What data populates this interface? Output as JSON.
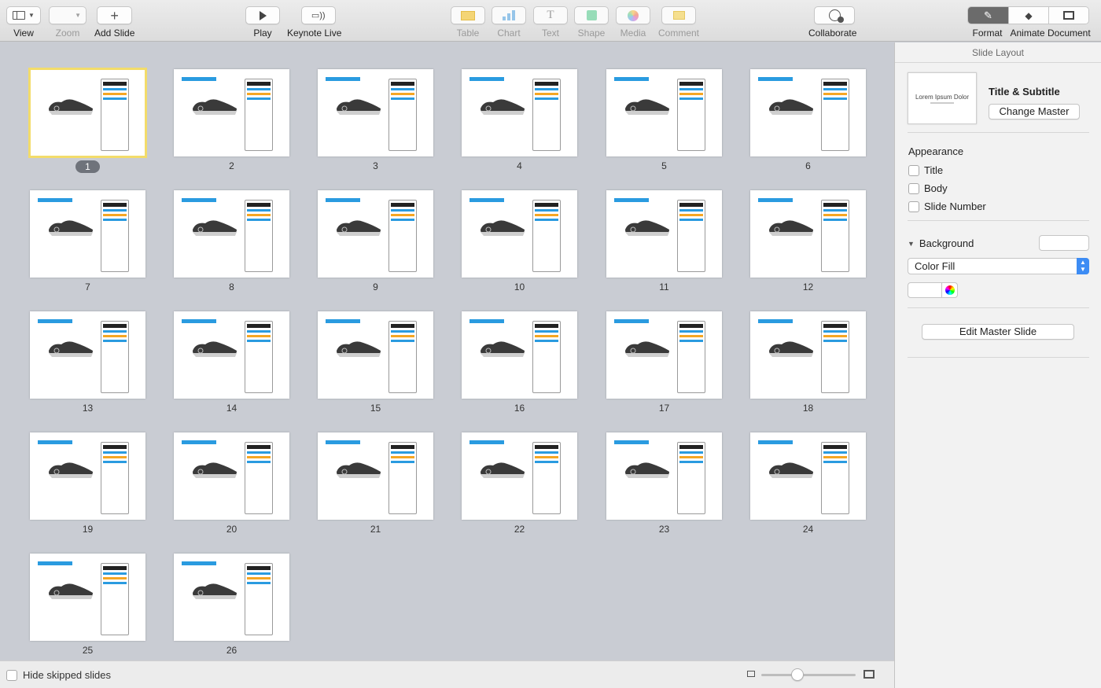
{
  "toolbar": {
    "view_label": "View",
    "zoom_label": "Zoom",
    "add_slide_label": "Add Slide",
    "play_label": "Play",
    "keynote_live_label": "Keynote Live",
    "table_label": "Table",
    "chart_label": "Chart",
    "text_label": "Text",
    "shape_label": "Shape",
    "media_label": "Media",
    "comment_label": "Comment",
    "collaborate_label": "Collaborate",
    "format_label": "Format",
    "animate_label": "Animate",
    "document_label": "Document"
  },
  "slides": [
    {
      "num": "1"
    },
    {
      "num": "2"
    },
    {
      "num": "3"
    },
    {
      "num": "4"
    },
    {
      "num": "5"
    },
    {
      "num": "6"
    },
    {
      "num": "7"
    },
    {
      "num": "8"
    },
    {
      "num": "9"
    },
    {
      "num": "10"
    },
    {
      "num": "11"
    },
    {
      "num": "12"
    },
    {
      "num": "13"
    },
    {
      "num": "14"
    },
    {
      "num": "15"
    },
    {
      "num": "16"
    },
    {
      "num": "17"
    },
    {
      "num": "18"
    },
    {
      "num": "19"
    },
    {
      "num": "20"
    },
    {
      "num": "21"
    },
    {
      "num": "22"
    },
    {
      "num": "23"
    },
    {
      "num": "24"
    },
    {
      "num": "25"
    },
    {
      "num": "26"
    }
  ],
  "selected_slide": "1",
  "bottom": {
    "hide_skipped_label": "Hide skipped slides"
  },
  "inspector": {
    "panel_title": "Slide Layout",
    "master_name": "Title & Subtitle",
    "master_thumb_title": "Lorem Ipsum Dolor",
    "change_master_label": "Change Master",
    "appearance_label": "Appearance",
    "title_checkbox": "Title",
    "body_checkbox": "Body",
    "slide_number_checkbox": "Slide Number",
    "background_label": "Background",
    "fill_type": "Color Fill",
    "edit_master_label": "Edit Master Slide"
  },
  "colors": {
    "selection": "#f3dc6a",
    "accent_blue": "#2a9be0",
    "accent_orange": "#f5a623",
    "select_blue": "#3d8cf4"
  }
}
